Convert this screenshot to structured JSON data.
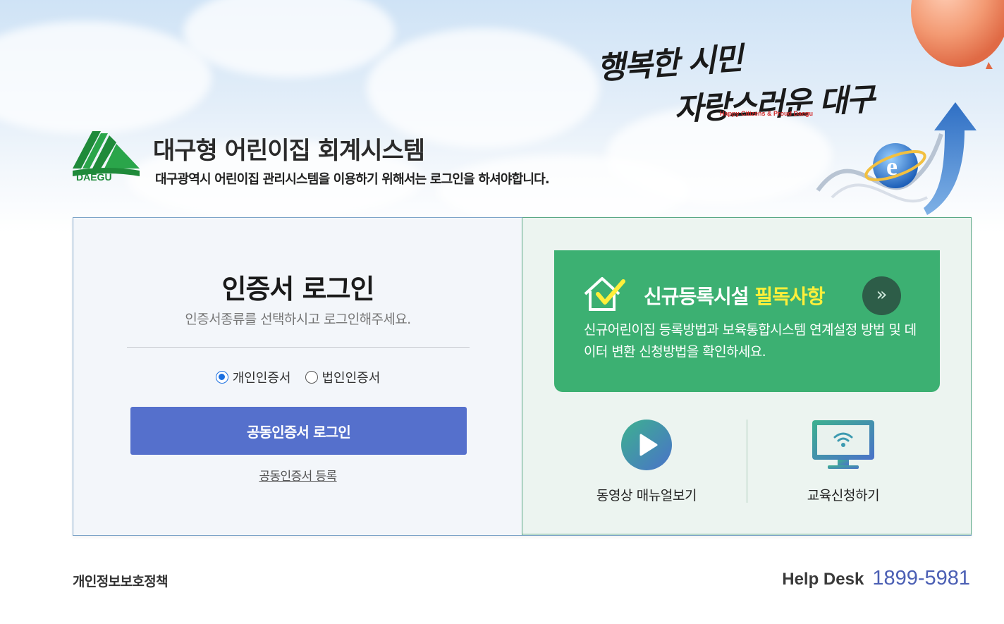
{
  "header": {
    "logo_text": "DAEGU",
    "title": "대구형 어린이집 회계시스템",
    "subtitle": "대구광역시 어린이집 관리시스템을 이용하기 위해서는 로그인을 하셔야합니다.",
    "slogan_line1": "행복한 시민",
    "slogan_line2": "자랑스러운 대구",
    "slogan_en": "Happy Citizens & Proud Daegu"
  },
  "login": {
    "title": "인증서 로그인",
    "subtitle": "인증서종류를 선택하시고 로그인해주세요.",
    "options": [
      {
        "label": "개인인증서",
        "selected": true
      },
      {
        "label": "법인인증서",
        "selected": false
      }
    ],
    "button_label": "공동인증서 로그인",
    "register_link": "공동인증서 등록"
  },
  "notice": {
    "title_prefix": "신규등록시설",
    "title_highlight": "필독사항",
    "body": "신규어린이집 등록방법과 보육통합시스템 연계설정 방법 및 데이터 변환 신청방법을 확인하세요.",
    "arrow_icon": "double-chevron-right-icon"
  },
  "menu": {
    "video_label": "동영상 매뉴얼보기",
    "edu_label": "교육신청하기"
  },
  "footer": {
    "privacy": "개인정보보호정책",
    "helpdesk_label": "Help Desk",
    "helpdesk_number": "1899-5981"
  },
  "colors": {
    "login_button": "#5570cc",
    "notice_bg": "#3cb072",
    "notice_highlight": "#ffef3a",
    "helpdesk_number": "#4b5fb4"
  }
}
